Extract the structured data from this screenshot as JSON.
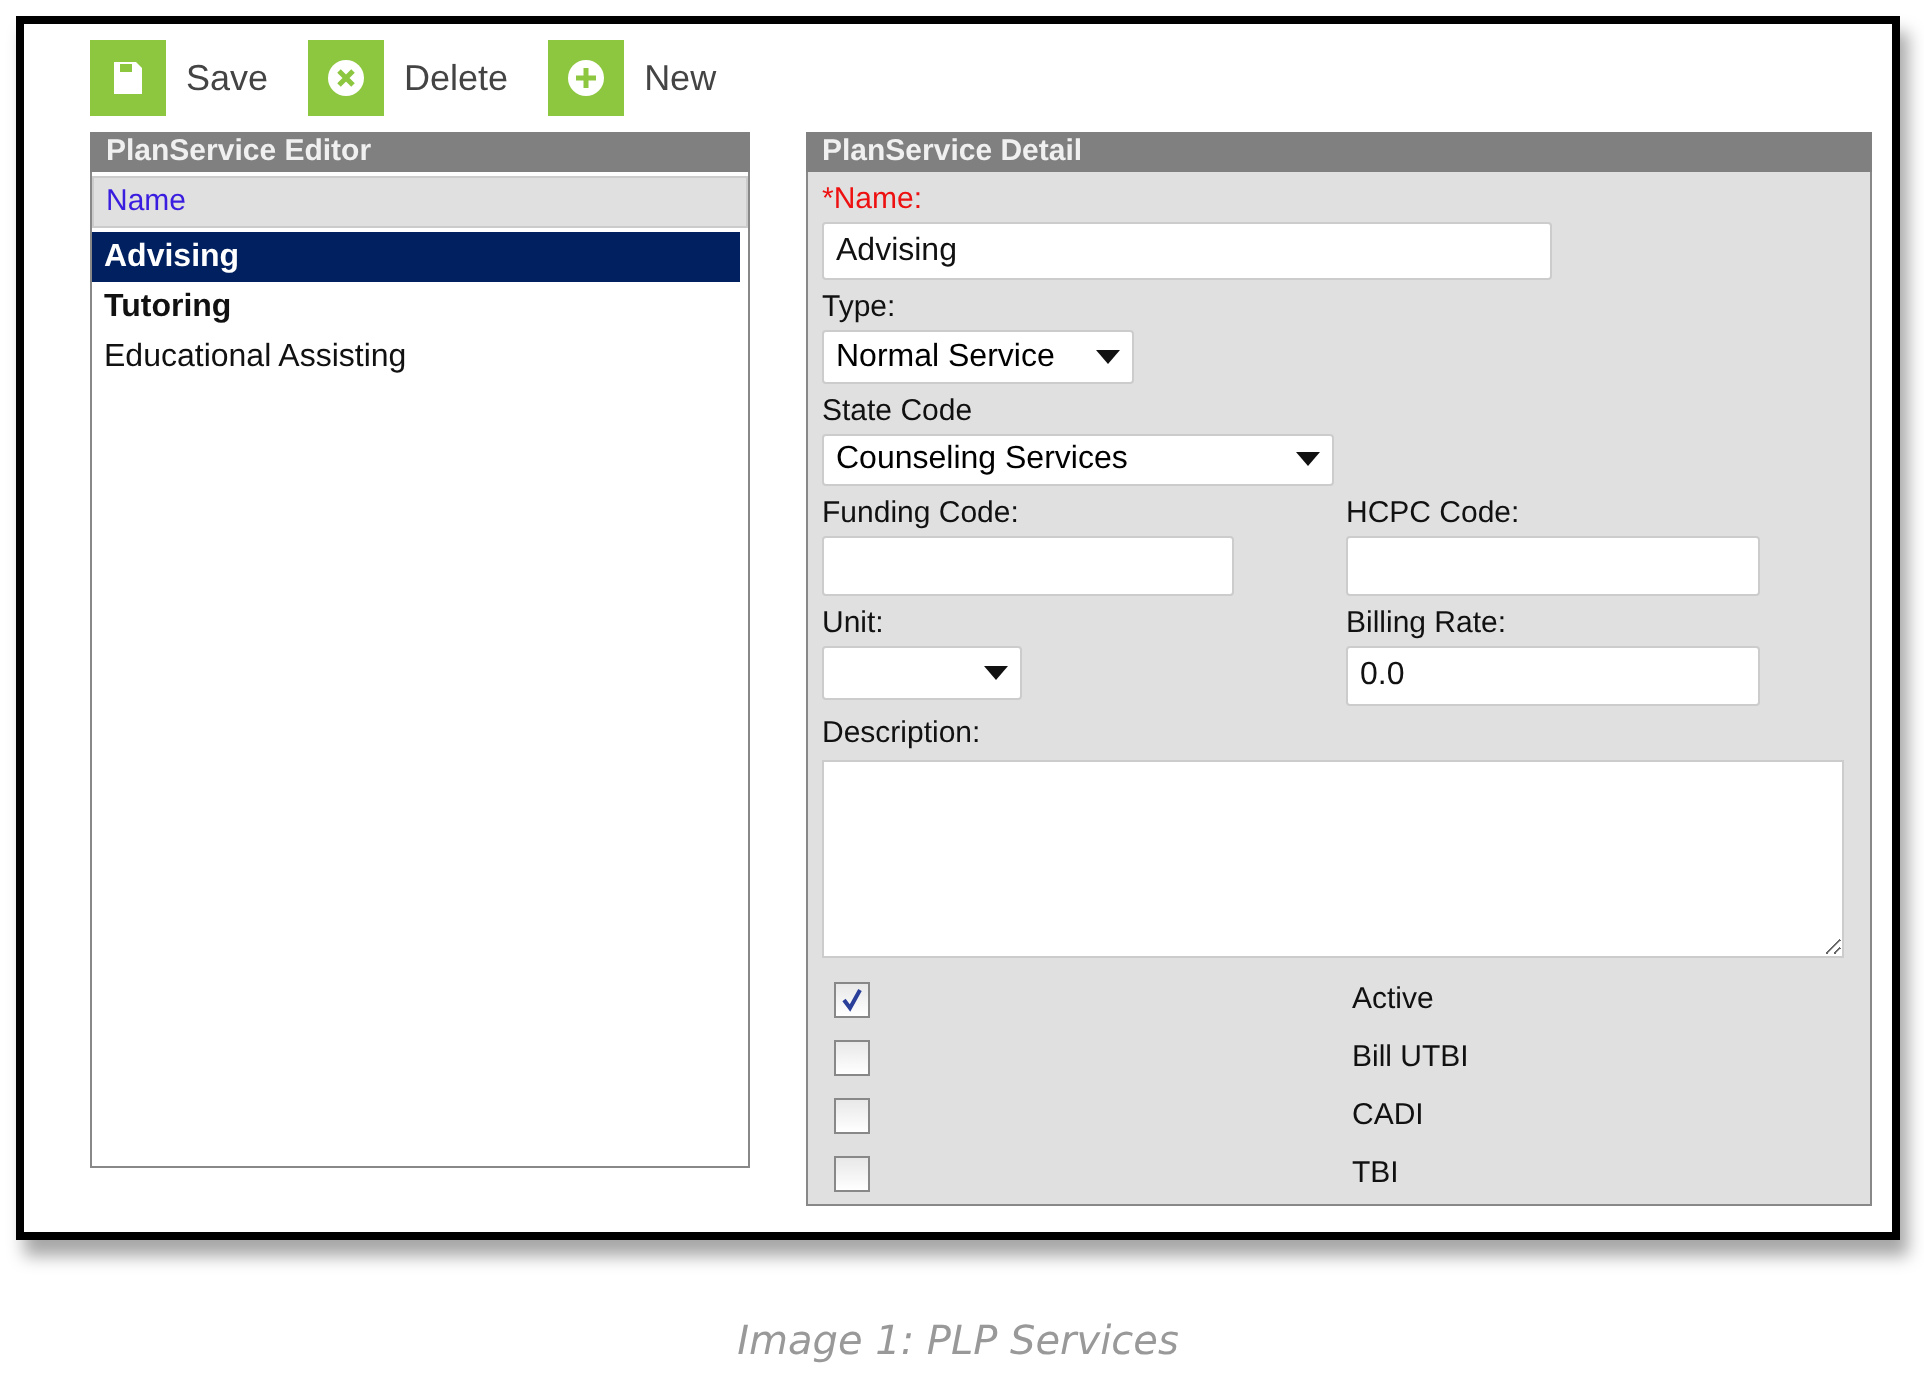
{
  "toolbar": [
    {
      "kind": "save",
      "label": "Save"
    },
    {
      "kind": "delete",
      "label": "Delete"
    },
    {
      "kind": "new",
      "label": "New"
    }
  ],
  "editor": {
    "title": "PlanService Editor",
    "column": "Name",
    "rows": [
      {
        "label": "Advising",
        "selected": true,
        "bold": true
      },
      {
        "label": "Tutoring",
        "selected": false,
        "bold": true
      },
      {
        "label": "Educational Assisting",
        "selected": false,
        "bold": false
      }
    ]
  },
  "detail": {
    "title": "PlanService Detail",
    "name": {
      "label": "*Name:",
      "value": "Advising"
    },
    "type": {
      "label": "Type:",
      "value": "Normal Service"
    },
    "state_code": {
      "label": "State Code",
      "value": "Counseling Services"
    },
    "funding_code": {
      "label": "Funding Code:"
    },
    "hcpc_code": {
      "label": "HCPC Code:"
    },
    "unit": {
      "label": "Unit:"
    },
    "billing_rate": {
      "label": "Billing Rate:",
      "value": "0.0"
    },
    "description": {
      "label": "Description:"
    },
    "checkboxes": [
      {
        "label": "Active",
        "checked": true
      },
      {
        "label": "Bill UTBI",
        "checked": false
      },
      {
        "label": "CADI",
        "checked": false
      },
      {
        "label": "TBI",
        "checked": false
      }
    ]
  },
  "caption": "Image 1: PLP Services"
}
